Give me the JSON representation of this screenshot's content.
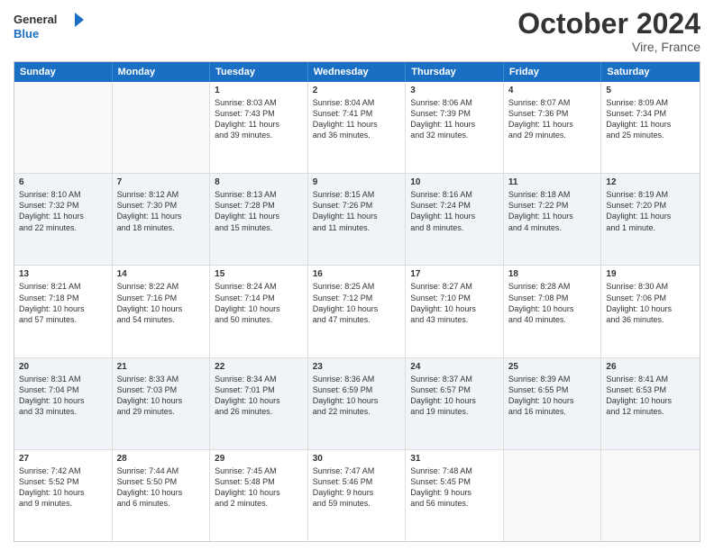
{
  "header": {
    "logo_line1": "General",
    "logo_line2": "Blue",
    "month": "October 2024",
    "location": "Vire, France"
  },
  "weekdays": [
    "Sunday",
    "Monday",
    "Tuesday",
    "Wednesday",
    "Thursday",
    "Friday",
    "Saturday"
  ],
  "rows": [
    {
      "alt": false,
      "cells": [
        {
          "day": "",
          "lines": []
        },
        {
          "day": "",
          "lines": []
        },
        {
          "day": "1",
          "lines": [
            "Sunrise: 8:03 AM",
            "Sunset: 7:43 PM",
            "Daylight: 11 hours",
            "and 39 minutes."
          ]
        },
        {
          "day": "2",
          "lines": [
            "Sunrise: 8:04 AM",
            "Sunset: 7:41 PM",
            "Daylight: 11 hours",
            "and 36 minutes."
          ]
        },
        {
          "day": "3",
          "lines": [
            "Sunrise: 8:06 AM",
            "Sunset: 7:39 PM",
            "Daylight: 11 hours",
            "and 32 minutes."
          ]
        },
        {
          "day": "4",
          "lines": [
            "Sunrise: 8:07 AM",
            "Sunset: 7:36 PM",
            "Daylight: 11 hours",
            "and 29 minutes."
          ]
        },
        {
          "day": "5",
          "lines": [
            "Sunrise: 8:09 AM",
            "Sunset: 7:34 PM",
            "Daylight: 11 hours",
            "and 25 minutes."
          ]
        }
      ]
    },
    {
      "alt": true,
      "cells": [
        {
          "day": "6",
          "lines": [
            "Sunrise: 8:10 AM",
            "Sunset: 7:32 PM",
            "Daylight: 11 hours",
            "and 22 minutes."
          ]
        },
        {
          "day": "7",
          "lines": [
            "Sunrise: 8:12 AM",
            "Sunset: 7:30 PM",
            "Daylight: 11 hours",
            "and 18 minutes."
          ]
        },
        {
          "day": "8",
          "lines": [
            "Sunrise: 8:13 AM",
            "Sunset: 7:28 PM",
            "Daylight: 11 hours",
            "and 15 minutes."
          ]
        },
        {
          "day": "9",
          "lines": [
            "Sunrise: 8:15 AM",
            "Sunset: 7:26 PM",
            "Daylight: 11 hours",
            "and 11 minutes."
          ]
        },
        {
          "day": "10",
          "lines": [
            "Sunrise: 8:16 AM",
            "Sunset: 7:24 PM",
            "Daylight: 11 hours",
            "and 8 minutes."
          ]
        },
        {
          "day": "11",
          "lines": [
            "Sunrise: 8:18 AM",
            "Sunset: 7:22 PM",
            "Daylight: 11 hours",
            "and 4 minutes."
          ]
        },
        {
          "day": "12",
          "lines": [
            "Sunrise: 8:19 AM",
            "Sunset: 7:20 PM",
            "Daylight: 11 hours",
            "and 1 minute."
          ]
        }
      ]
    },
    {
      "alt": false,
      "cells": [
        {
          "day": "13",
          "lines": [
            "Sunrise: 8:21 AM",
            "Sunset: 7:18 PM",
            "Daylight: 10 hours",
            "and 57 minutes."
          ]
        },
        {
          "day": "14",
          "lines": [
            "Sunrise: 8:22 AM",
            "Sunset: 7:16 PM",
            "Daylight: 10 hours",
            "and 54 minutes."
          ]
        },
        {
          "day": "15",
          "lines": [
            "Sunrise: 8:24 AM",
            "Sunset: 7:14 PM",
            "Daylight: 10 hours",
            "and 50 minutes."
          ]
        },
        {
          "day": "16",
          "lines": [
            "Sunrise: 8:25 AM",
            "Sunset: 7:12 PM",
            "Daylight: 10 hours",
            "and 47 minutes."
          ]
        },
        {
          "day": "17",
          "lines": [
            "Sunrise: 8:27 AM",
            "Sunset: 7:10 PM",
            "Daylight: 10 hours",
            "and 43 minutes."
          ]
        },
        {
          "day": "18",
          "lines": [
            "Sunrise: 8:28 AM",
            "Sunset: 7:08 PM",
            "Daylight: 10 hours",
            "and 40 minutes."
          ]
        },
        {
          "day": "19",
          "lines": [
            "Sunrise: 8:30 AM",
            "Sunset: 7:06 PM",
            "Daylight: 10 hours",
            "and 36 minutes."
          ]
        }
      ]
    },
    {
      "alt": true,
      "cells": [
        {
          "day": "20",
          "lines": [
            "Sunrise: 8:31 AM",
            "Sunset: 7:04 PM",
            "Daylight: 10 hours",
            "and 33 minutes."
          ]
        },
        {
          "day": "21",
          "lines": [
            "Sunrise: 8:33 AM",
            "Sunset: 7:03 PM",
            "Daylight: 10 hours",
            "and 29 minutes."
          ]
        },
        {
          "day": "22",
          "lines": [
            "Sunrise: 8:34 AM",
            "Sunset: 7:01 PM",
            "Daylight: 10 hours",
            "and 26 minutes."
          ]
        },
        {
          "day": "23",
          "lines": [
            "Sunrise: 8:36 AM",
            "Sunset: 6:59 PM",
            "Daylight: 10 hours",
            "and 22 minutes."
          ]
        },
        {
          "day": "24",
          "lines": [
            "Sunrise: 8:37 AM",
            "Sunset: 6:57 PM",
            "Daylight: 10 hours",
            "and 19 minutes."
          ]
        },
        {
          "day": "25",
          "lines": [
            "Sunrise: 8:39 AM",
            "Sunset: 6:55 PM",
            "Daylight: 10 hours",
            "and 16 minutes."
          ]
        },
        {
          "day": "26",
          "lines": [
            "Sunrise: 8:41 AM",
            "Sunset: 6:53 PM",
            "Daylight: 10 hours",
            "and 12 minutes."
          ]
        }
      ]
    },
    {
      "alt": false,
      "cells": [
        {
          "day": "27",
          "lines": [
            "Sunrise: 7:42 AM",
            "Sunset: 5:52 PM",
            "Daylight: 10 hours",
            "and 9 minutes."
          ]
        },
        {
          "day": "28",
          "lines": [
            "Sunrise: 7:44 AM",
            "Sunset: 5:50 PM",
            "Daylight: 10 hours",
            "and 6 minutes."
          ]
        },
        {
          "day": "29",
          "lines": [
            "Sunrise: 7:45 AM",
            "Sunset: 5:48 PM",
            "Daylight: 10 hours",
            "and 2 minutes."
          ]
        },
        {
          "day": "30",
          "lines": [
            "Sunrise: 7:47 AM",
            "Sunset: 5:46 PM",
            "Daylight: 9 hours",
            "and 59 minutes."
          ]
        },
        {
          "day": "31",
          "lines": [
            "Sunrise: 7:48 AM",
            "Sunset: 5:45 PM",
            "Daylight: 9 hours",
            "and 56 minutes."
          ]
        },
        {
          "day": "",
          "lines": []
        },
        {
          "day": "",
          "lines": []
        }
      ]
    }
  ]
}
